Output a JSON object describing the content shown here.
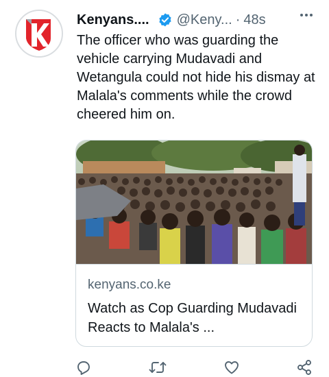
{
  "tweet": {
    "author_name": "Kenyans....",
    "handle": "@Keny...",
    "separator": "·",
    "time": "48s",
    "avatar_icon": "kenyans-logo",
    "verified_icon": "verified-badge-icon",
    "text": "The officer who was guarding the vehicle carrying Mudavadi and Wetangula could not hide his dismay at Malala's comments while the crowd cheered him on."
  },
  "card": {
    "domain": "kenyans.co.ke",
    "title": "Watch as Cop Guarding Mudavadi Reacts to Malala's ..."
  },
  "actions": [
    {
      "icon": "reply-icon"
    },
    {
      "icon": "retweet-icon"
    },
    {
      "icon": "like-icon"
    },
    {
      "icon": "share-icon"
    }
  ],
  "colors": {
    "text": "#0f1419",
    "secondary": "#536471",
    "accent": "#1d9bf0",
    "brand_red": "#e2242b",
    "border": "#cfd9de"
  }
}
